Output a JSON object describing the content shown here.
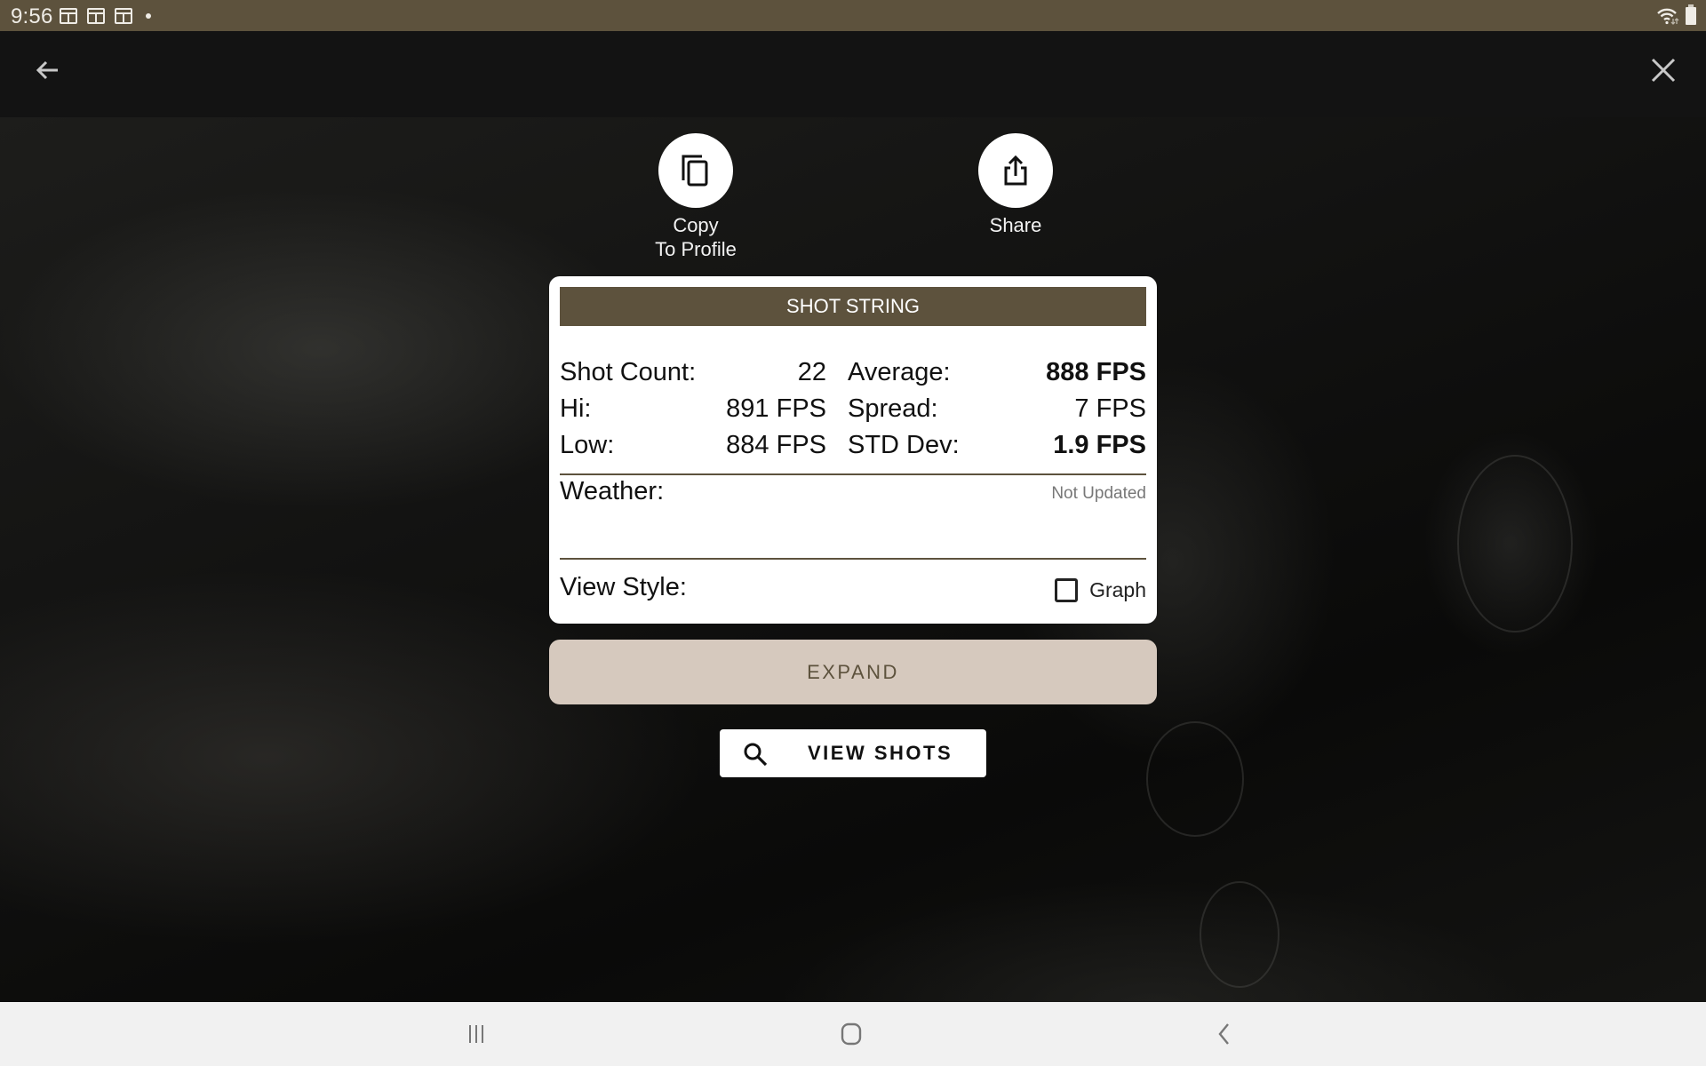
{
  "status_bar": {
    "time": "9:56",
    "notification_icons": [
      "news-icon",
      "news-icon",
      "news-icon"
    ],
    "icons": [
      "more-notifications-dot",
      "wifi-icon",
      "battery-icon"
    ]
  },
  "app_bar": {
    "back_icon": "arrow-left-icon",
    "close_icon": "close-icon"
  },
  "actions": [
    {
      "label": "Copy\nTo Profile",
      "icon": "copy-icon"
    },
    {
      "label": "Share",
      "icon": "share-icon"
    }
  ],
  "card": {
    "title": "SHOT STRING",
    "stats": [
      {
        "label": "Shot Count:",
        "value": "22",
        "label2": "Average:",
        "value2": "888 FPS"
      },
      {
        "label": "Hi:",
        "value": "891 FPS",
        "label2": "Spread:",
        "value2": "7 FPS"
      },
      {
        "label": "Low:",
        "value": "884 FPS",
        "label2": "STD Dev:",
        "value2": "1.9 FPS"
      }
    ],
    "weather_label": "Weather:",
    "weather_status": "Not Updated",
    "view_style_label": "View Style:",
    "graph_label": "Graph",
    "graph_checked": false
  },
  "buttons": {
    "expand": "EXPAND",
    "view_shots": "VIEW SHOTS"
  },
  "nav_bar": {
    "icons": [
      "recent-apps-icon",
      "home-icon",
      "back-icon"
    ]
  },
  "colors": {
    "brand": "#5d523d",
    "expand_bg": "#d6c9be",
    "app_bar": "#131313",
    "nav_bar": "#f1f1f1"
  }
}
